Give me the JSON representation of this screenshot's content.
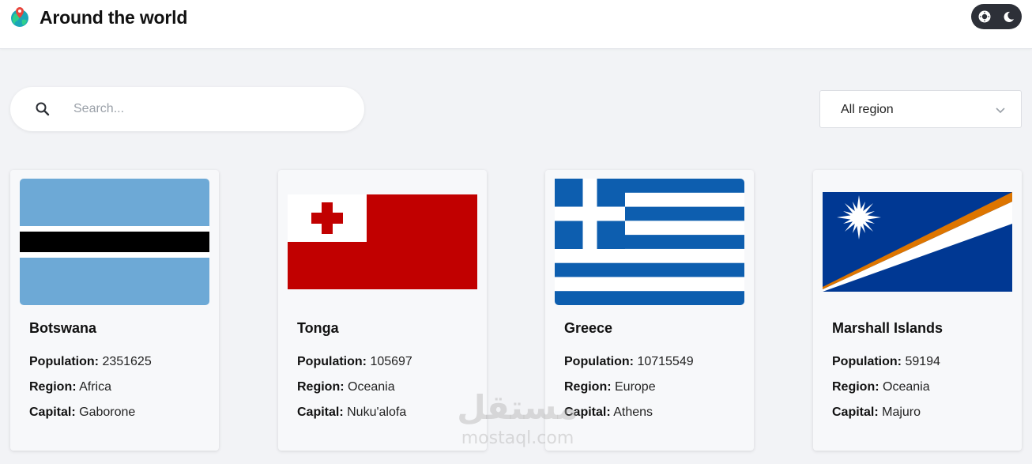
{
  "header": {
    "title": "Around the world",
    "logo_icon": "globe-pin-icon",
    "theme_toggle": {
      "light_icon": "sun-icon",
      "dark_icon": "moon-icon"
    }
  },
  "search": {
    "placeholder": "Search...",
    "value": "",
    "icon": "search-icon"
  },
  "region_filter": {
    "selected": "All region",
    "icon": "chevron-down-icon"
  },
  "labels": {
    "population": "Population:",
    "region": "Region:",
    "capital": "Capital:"
  },
  "countries": [
    {
      "name": "Botswana",
      "population": "2351625",
      "region": "Africa",
      "capital": "Gaborone",
      "flag": "botswana-flag"
    },
    {
      "name": "Tonga",
      "population": "105697",
      "region": "Oceania",
      "capital": "Nuku'alofa",
      "flag": "tonga-flag"
    },
    {
      "name": "Greece",
      "population": "10715549",
      "region": "Europe",
      "capital": "Athens",
      "flag": "greece-flag"
    },
    {
      "name": "Marshall Islands",
      "population": "59194",
      "region": "Oceania",
      "capital": "Majuro",
      "flag": "marshall-islands-flag"
    }
  ],
  "watermark": {
    "arabic": "مستقل",
    "latin": "mostaql.com"
  },
  "colors": {
    "background": "#f2f3f6",
    "header_bg": "#ffffff",
    "card_bg": "#f7f8fa",
    "toggle_bg": "#2d3038"
  }
}
